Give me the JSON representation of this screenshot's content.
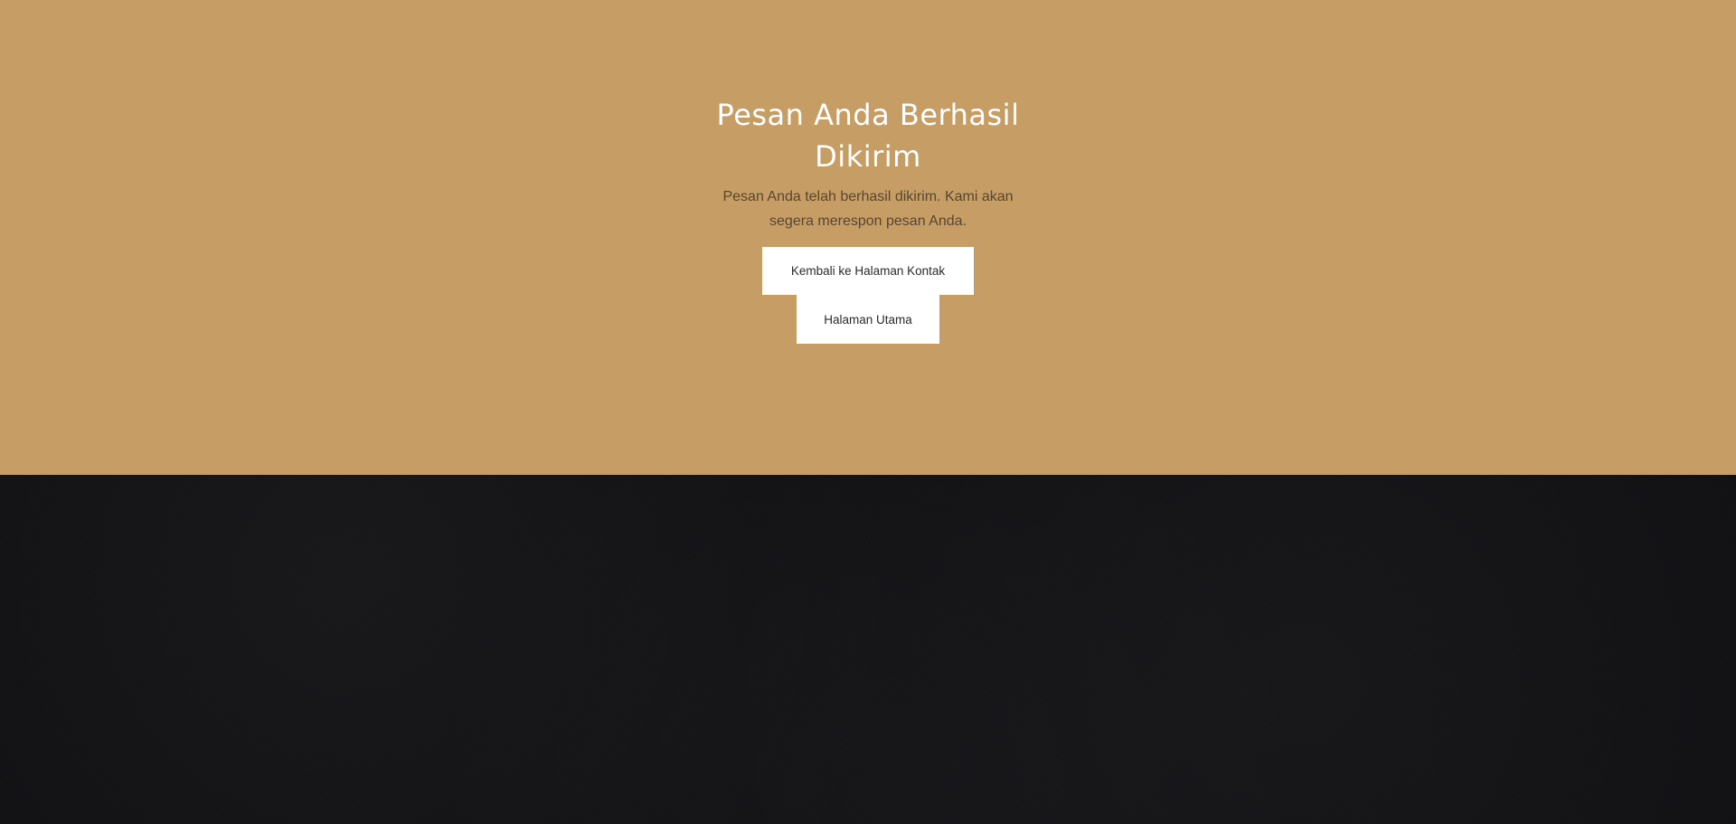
{
  "hero": {
    "background_color": "#c59d65",
    "title": "Pesan Anda Berhasil Dikirim",
    "message": "Pesan Anda telah berhasil dikirim. Kami akan segera merespon pesan Anda.",
    "buttons": {
      "contact_label": "Kembali ke Halaman Kontak",
      "home_label": "Halaman Utama"
    }
  },
  "footer": {
    "background_color": "#101013"
  }
}
